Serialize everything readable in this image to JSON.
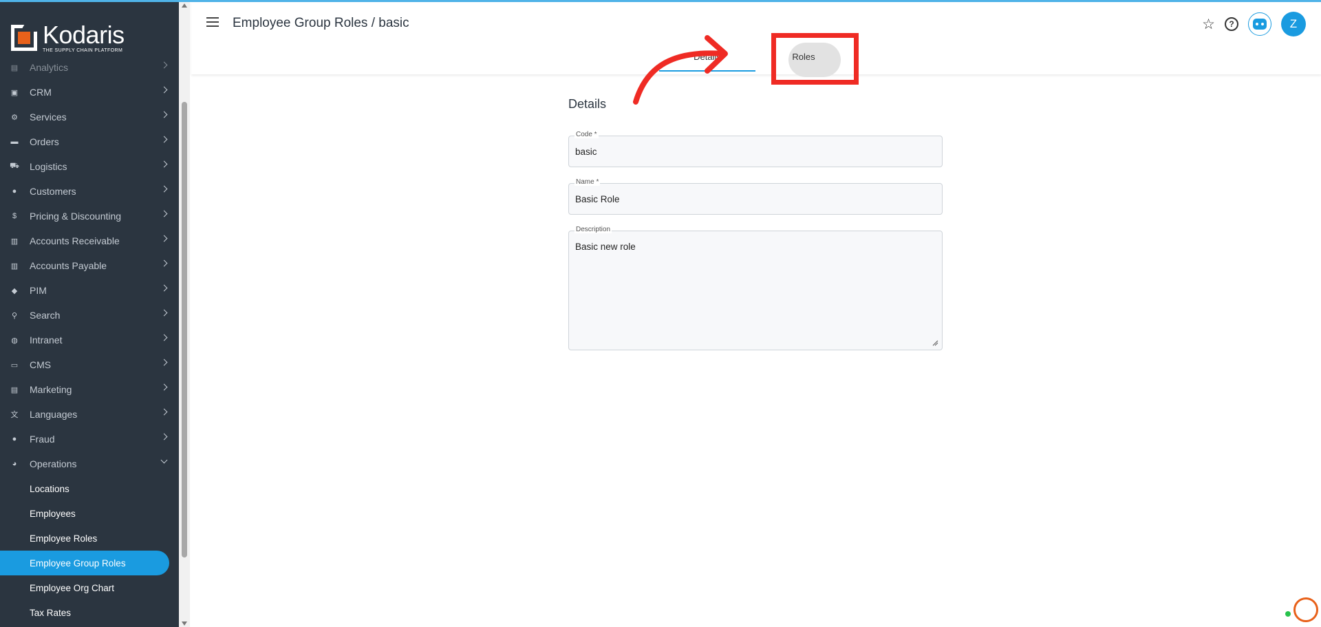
{
  "app": {
    "logo_name": "Kodaris",
    "logo_tagline": "THE SUPPLY CHAIN PLATFORM"
  },
  "header": {
    "title": "Employee Group Roles / basic",
    "avatar_initial": "Z",
    "tabs": [
      {
        "label": "Details",
        "active": true
      },
      {
        "label": "Roles",
        "active": false
      }
    ]
  },
  "sidebar": {
    "items": [
      {
        "label": "Analytics",
        "icon": "chart-icon"
      },
      {
        "label": "CRM",
        "icon": "contact-icon"
      },
      {
        "label": "Services",
        "icon": "gears-icon"
      },
      {
        "label": "Orders",
        "icon": "truck-icon"
      },
      {
        "label": "Logistics",
        "icon": "delivery-icon"
      },
      {
        "label": "Customers",
        "icon": "people-icon"
      },
      {
        "label": "Pricing & Discounting",
        "icon": "dollar-icon"
      },
      {
        "label": "Accounts Receivable",
        "icon": "bank-icon"
      },
      {
        "label": "Accounts Payable",
        "icon": "bank-icon"
      },
      {
        "label": "PIM",
        "icon": "tag-icon"
      },
      {
        "label": "Search",
        "icon": "search-icon"
      },
      {
        "label": "Intranet",
        "icon": "globe-icon"
      },
      {
        "label": "CMS",
        "icon": "web-icon"
      },
      {
        "label": "Marketing",
        "icon": "id-card-icon"
      },
      {
        "label": "Languages",
        "icon": "translate-icon"
      },
      {
        "label": "Fraud",
        "icon": "alert-icon"
      },
      {
        "label": "Operations",
        "icon": "palette-icon"
      }
    ],
    "operations_sub": [
      {
        "label": "Locations",
        "active": false
      },
      {
        "label": "Employees",
        "active": false
      },
      {
        "label": "Employee Roles",
        "active": false
      },
      {
        "label": "Employee Group Roles",
        "active": true
      },
      {
        "label": "Employee Org Chart",
        "active": false
      },
      {
        "label": "Tax Rates",
        "active": false
      }
    ]
  },
  "form": {
    "section_title": "Details",
    "code": {
      "label": "Code *",
      "value": "basic"
    },
    "name": {
      "label": "Name *",
      "value": "Basic Role"
    },
    "description": {
      "label": "Description",
      "value": "Basic new role"
    }
  },
  "colors": {
    "sidebar_bg": "#2b3540",
    "accent": "#1a9be0",
    "brand_orange": "#e8611a",
    "annotation_red": "#ef2b24"
  }
}
